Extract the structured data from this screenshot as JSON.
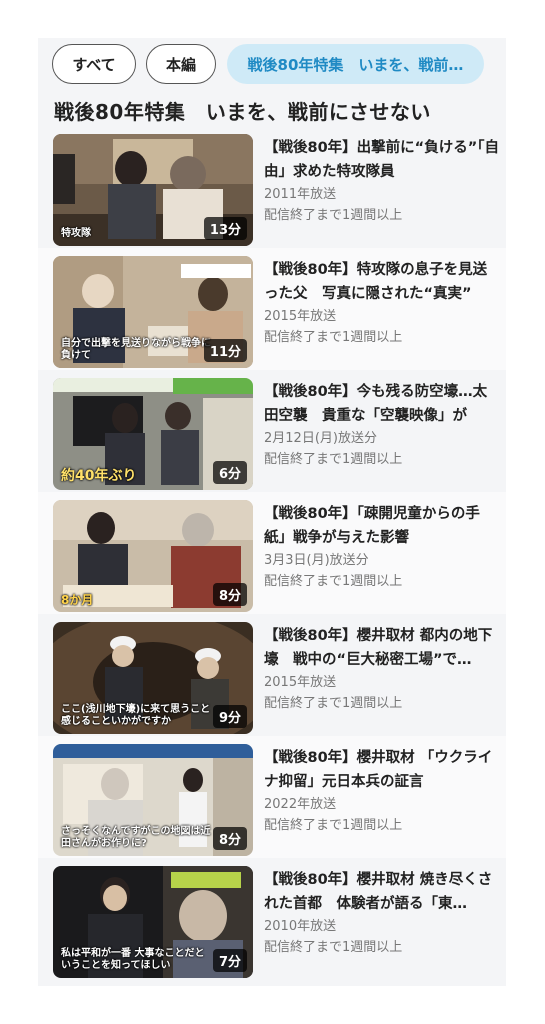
{
  "tabs": [
    {
      "label": "すべて",
      "active": false
    },
    {
      "label": "本編",
      "active": false
    },
    {
      "label": "戦後80年特集　いまを、戦前…",
      "active": true
    }
  ],
  "section_title": "戦後80年特集　いまを、戦前にさせない",
  "videos": [
    {
      "title": "【戦後80年】出撃前に“負ける”「自由」求めた特攻隊員",
      "air": "2011年放送",
      "availability": "配信終了まで1週間以上",
      "duration": "13分",
      "caption": "特攻隊"
    },
    {
      "title": "【戦後80年】特攻隊の息子を見送った父　写真に隠された“真実”",
      "air": "2015年放送",
      "availability": "配信終了まで1週間以上",
      "duration": "11分",
      "caption": "自分で出撃を見送りながら戦争に負けて"
    },
    {
      "title": "【戦後80年】今も残る防空壕…太田空襲　貴重な「空襲映像」が",
      "air": "2月12日(月)放送分",
      "availability": "配信終了まで1週間以上",
      "duration": "6分",
      "caption": "約40年ぶり"
    },
    {
      "title": "【戦後80年】「疎開児童からの手紙」戦争が与えた影響",
      "air": "3月3日(月)放送分",
      "availability": "配信終了まで1週間以上",
      "duration": "8分",
      "caption": "8か月"
    },
    {
      "title": "【戦後80年】櫻井取材 都内の地下壕　戦中の“巨大秘密工場”で…",
      "air": "2015年放送",
      "availability": "配信終了まで1週間以上",
      "duration": "9分",
      "caption": "ここ(浅川地下壕)に来て思うこと感じることいかがですか"
    },
    {
      "title": "【戦後80年】櫻井取材 「ウクライナ抑留」元日本兵の証言",
      "air": "2022年放送",
      "availability": "配信終了まで1週間以上",
      "duration": "8分",
      "caption": "さっそくなんですがこの地図は近田さんがお作りに?"
    },
    {
      "title": "【戦後80年】櫻井取材 焼き尽くされた首都　体験者が語る「東…",
      "air": "2010年放送",
      "availability": "配信終了まで1週間以上",
      "duration": "7分",
      "caption": "私は平和が一番 大事なことだということを知ってほしい"
    }
  ]
}
